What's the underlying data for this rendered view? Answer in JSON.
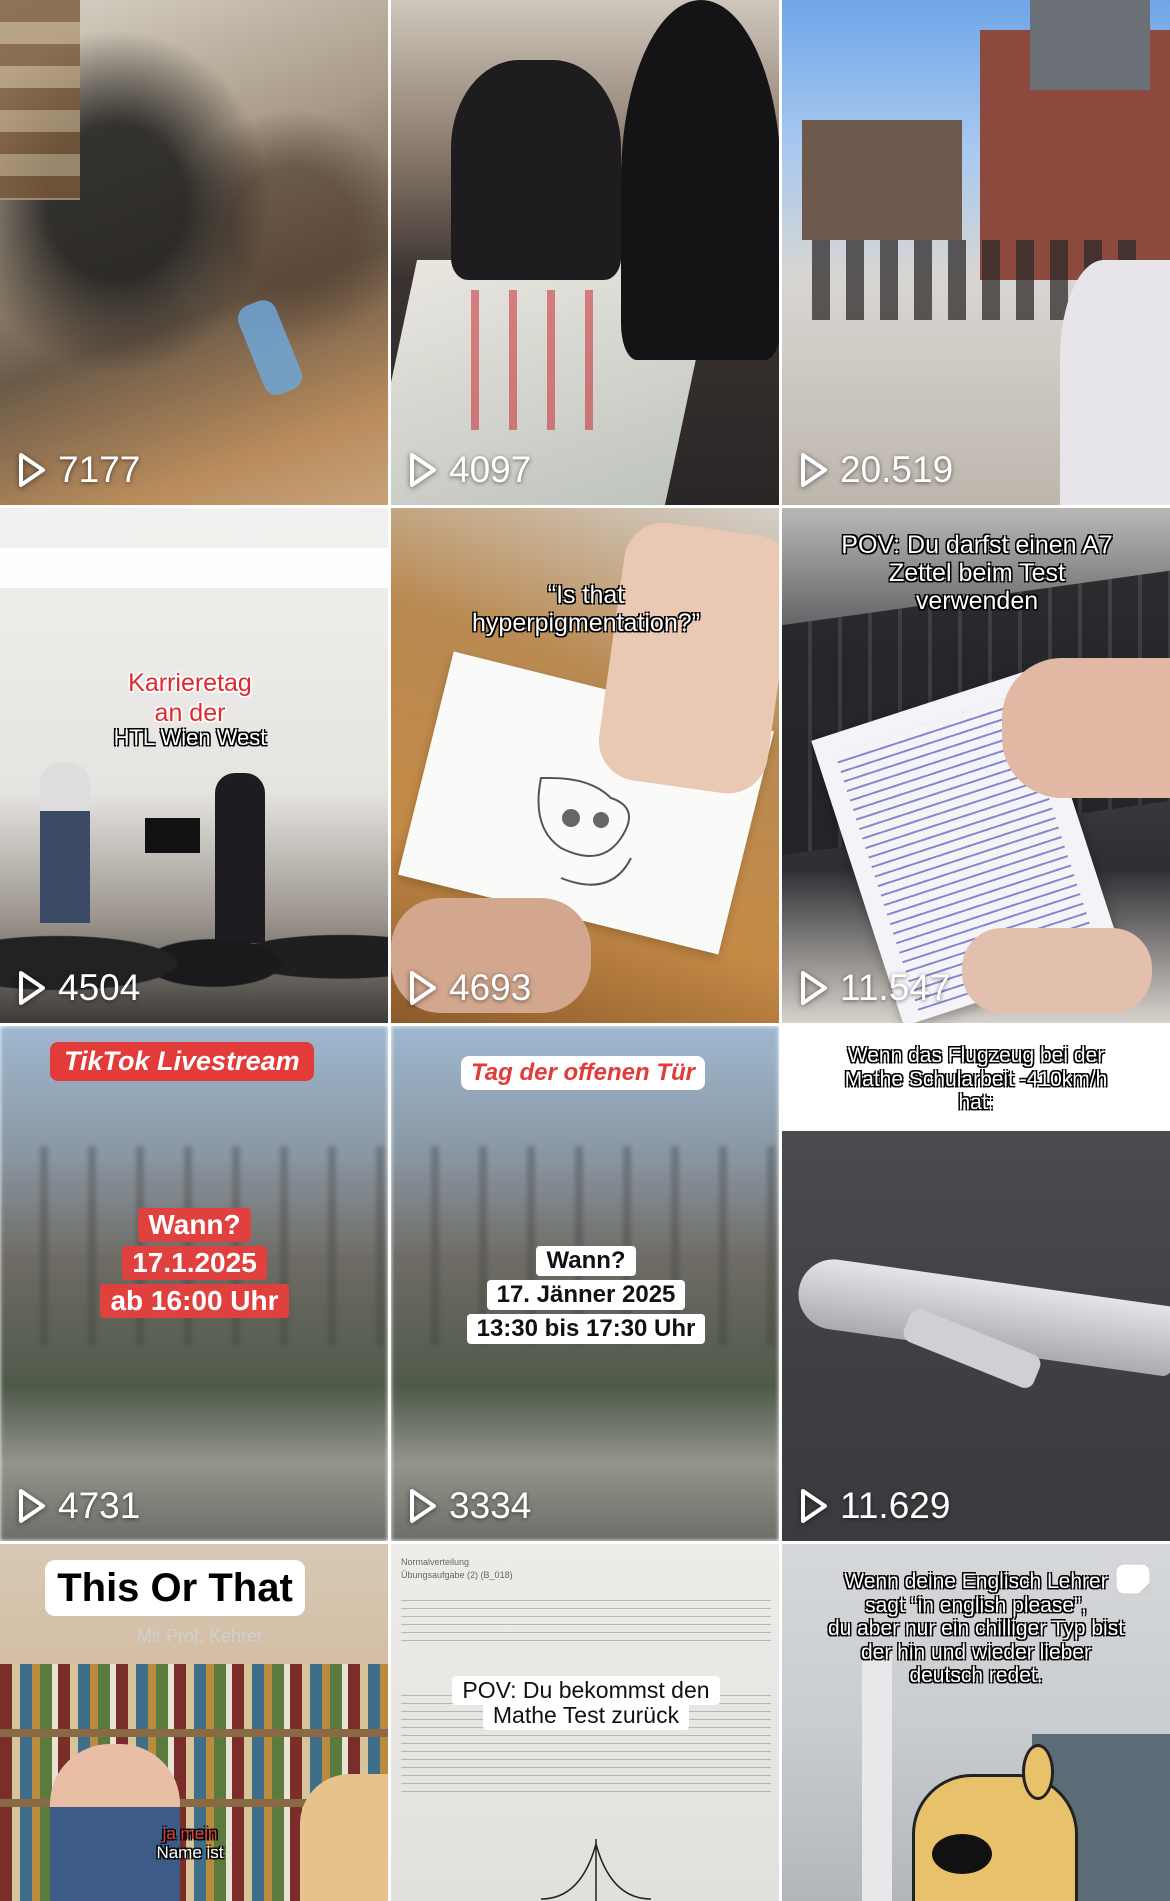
{
  "tiles": [
    {
      "views": "7177"
    },
    {
      "views": "4097"
    },
    {
      "views": "20.519"
    },
    {
      "views": "4504",
      "caption": [
        "Karrieretag",
        "an der",
        "HTL Wien West"
      ]
    },
    {
      "views": "4693",
      "caption": [
        "“Is that",
        "hyperpigmentation?”"
      ]
    },
    {
      "views": "11.547",
      "caption": [
        "POV: Du darfst einen A7",
        "Zettel beim Test",
        "verwenden"
      ]
    },
    {
      "views": "4731",
      "banner": "TikTok Livestream",
      "lines": [
        "Wann?",
        "17.1.2025",
        "ab 16:00 Uhr"
      ]
    },
    {
      "views": "3334",
      "banner": "Tag der offenen Tür",
      "lines": [
        "Wann?",
        "17. Jänner 2025",
        "13:30 bis 17:30 Uhr"
      ]
    },
    {
      "views": "11.629",
      "caption": [
        "Wenn das Flugzeug bei der",
        "Mathe Schularbeit -410km/h",
        "hat:"
      ]
    },
    {
      "title": "This Or That",
      "subtitle": "Mit Prof. Kehrer",
      "subcaption": [
        "ja mein",
        "Name ist"
      ]
    },
    {
      "caption": [
        "POV: Du bekommst den",
        "Mathe  Test zurück"
      ],
      "doc": [
        "Normalverteilung",
        "Übungsaufgabe (2) (B_018)"
      ]
    },
    {
      "caption": [
        "Wenn deine Englisch Lehrer",
        "sagt “in english please”,",
        "du aber nur ein chilliger Typ bist",
        "der hin und wieder lieber",
        "deutsch redet."
      ]
    }
  ],
  "icons": {
    "play": "play-icon",
    "sticker": "sticker-icon"
  }
}
